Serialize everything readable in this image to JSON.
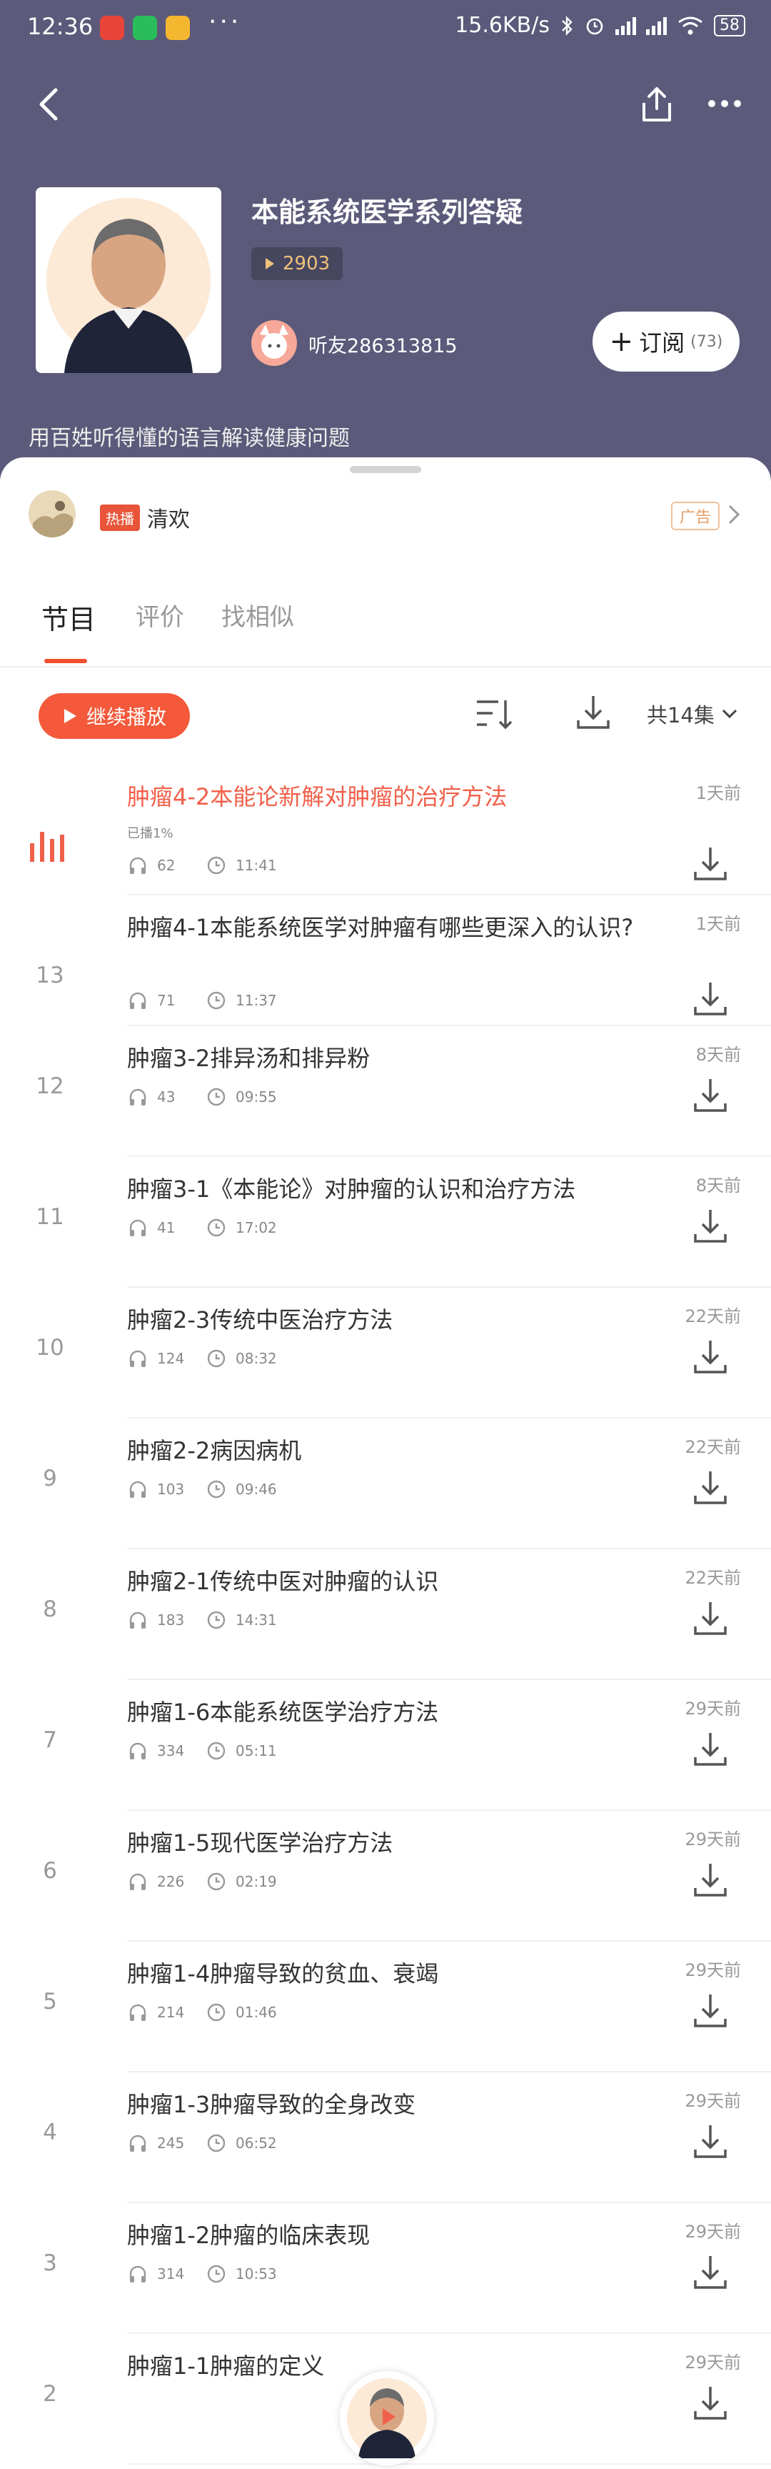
{
  "status_bar": {
    "time": "12:36",
    "network_speed": "15.6KB/s",
    "battery": "58",
    "dots": "···"
  },
  "album": {
    "title": "本能系统医学系列答疑",
    "play_count": "2903",
    "author": "听友286313815",
    "subscribe_label": "订阅",
    "subscribe_count": "(73)",
    "description": "用百姓听得懂的语言解读健康问题"
  },
  "ad": {
    "hot_badge": "热播",
    "name": "清欢",
    "ad_label": "广告"
  },
  "tabs": [
    {
      "label": "节目"
    },
    {
      "label": "评价"
    },
    {
      "label": "找相似"
    }
  ],
  "toolbar": {
    "continue_label": "继续播放",
    "episode_count": "共14集"
  },
  "episodes": [
    {
      "num": "",
      "title": "肿瘤4-2本能论新解对肿瘤的治疗方法",
      "progress": "已播1%",
      "plays": "62",
      "duration": "11:41",
      "date": "1天前",
      "playing": true
    },
    {
      "num": "13",
      "title": "肿瘤4-1本能系统医学对肿瘤有哪些更深入的认识?",
      "plays": "71",
      "duration": "11:37",
      "date": "1天前"
    },
    {
      "num": "12",
      "title": "肿瘤3-2排异汤和排异粉",
      "plays": "43",
      "duration": "09:55",
      "date": "8天前"
    },
    {
      "num": "11",
      "title": "肿瘤3-1《本能论》对肿瘤的认识和治疗方法",
      "plays": "41",
      "duration": "17:02",
      "date": "8天前"
    },
    {
      "num": "10",
      "title": "肿瘤2-3传统中医治疗方法",
      "plays": "124",
      "duration": "08:32",
      "date": "22天前"
    },
    {
      "num": "9",
      "title": "肿瘤2-2病因病机",
      "plays": "103",
      "duration": "09:46",
      "date": "22天前"
    },
    {
      "num": "8",
      "title": "肿瘤2-1传统中医对肿瘤的认识",
      "plays": "183",
      "duration": "14:31",
      "date": "22天前"
    },
    {
      "num": "7",
      "title": "肿瘤1-6本能系统医学治疗方法",
      "plays": "334",
      "duration": "05:11",
      "date": "29天前"
    },
    {
      "num": "6",
      "title": "肿瘤1-5现代医学治疗方法",
      "plays": "226",
      "duration": "02:19",
      "date": "29天前"
    },
    {
      "num": "5",
      "title": "肿瘤1-4肿瘤导致的贫血、衰竭",
      "plays": "214",
      "duration": "01:46",
      "date": "29天前"
    },
    {
      "num": "4",
      "title": "肿瘤1-3肿瘤导致的全身改变",
      "plays": "245",
      "duration": "06:52",
      "date": "29天前"
    },
    {
      "num": "3",
      "title": "肿瘤1-2肿瘤的临床表现",
      "plays": "314",
      "duration": "10:53",
      "date": "29天前"
    },
    {
      "num": "2",
      "title": "肿瘤1-1肿瘤的定义",
      "plays": "",
      "duration": "",
      "date": "29天前"
    }
  ]
}
